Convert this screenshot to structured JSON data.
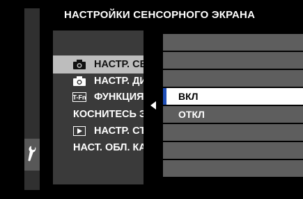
{
  "header": {
    "title": "НАСТРОЙКИ СЕНСОРНОГО ЭКРАНА"
  },
  "sidebar": {
    "icon": "wrench-icon"
  },
  "menu": {
    "items": [
      {
        "label": "НАСТР. СЕНСОРА",
        "icon": "camera-icon",
        "selected": true
      },
      {
        "label": "НАСТР. ДИСПЛЕЯ",
        "icon": "camera-icon",
        "selected": false
      },
      {
        "label": "ФУНКЦИЯ Fn",
        "icon": "fn-icon",
        "selected": false
      },
      {
        "label": "КОСНИТЕСЬ ЭКРАНА",
        "icon": "",
        "selected": false
      },
      {
        "label": "НАСТР. СЪЁМКИ",
        "icon": "play-icon",
        "selected": false
      },
      {
        "label": "НАСТ. ОБЛ. КАСАНИЯ",
        "icon": "",
        "selected": false
      }
    ]
  },
  "submenu": {
    "options": [
      {
        "label": "",
        "selected": false
      },
      {
        "label": "",
        "selected": false
      },
      {
        "label": "",
        "selected": false
      },
      {
        "label": "ВКЛ",
        "selected": true
      },
      {
        "label": "ОТКЛ",
        "selected": false
      },
      {
        "label": "",
        "selected": false
      },
      {
        "label": "",
        "selected": false
      },
      {
        "label": "",
        "selected": false
      }
    ]
  },
  "colors": {
    "selected_marker": "#1f4fb8",
    "menu_bg": "#3a3a3a",
    "submenu_bg": "#5e5e5e"
  }
}
